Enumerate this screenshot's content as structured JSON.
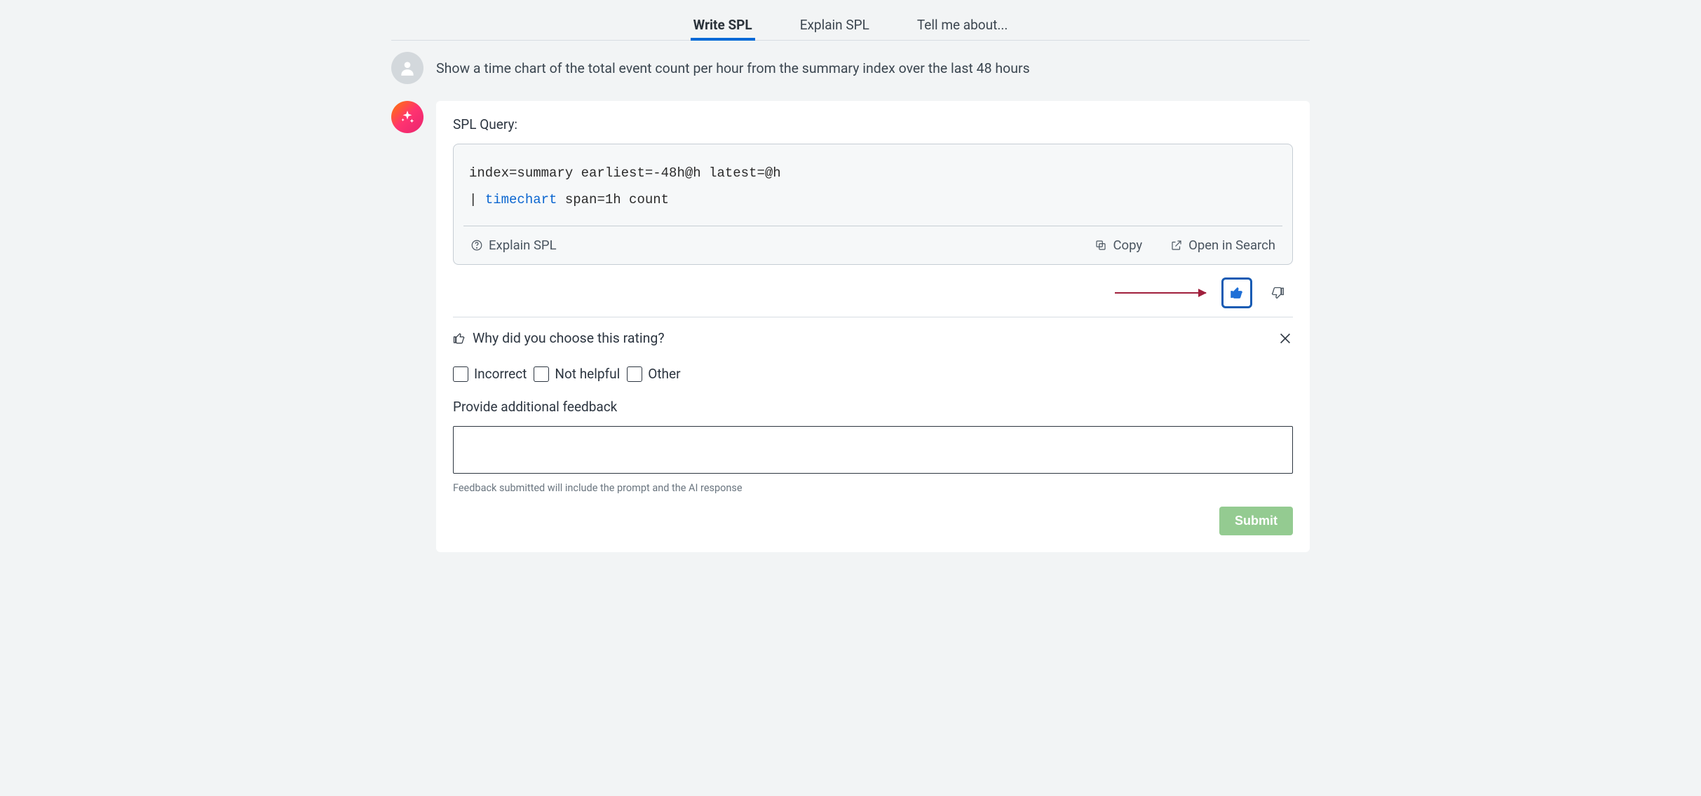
{
  "tabs": [
    {
      "label": "Write SPL",
      "active": true
    },
    {
      "label": "Explain SPL",
      "active": false
    },
    {
      "label": "Tell me about...",
      "active": false
    }
  ],
  "user_message": "Show a time chart of the total event count per hour from the summary index over the last 48 hours",
  "response": {
    "label": "SPL Query:",
    "code_line1": "index=summary earliest=-48h@h latest=@h",
    "code_pipe": "| ",
    "code_keyword": "timechart",
    "code_rest": " span=1h count",
    "explain_label": "Explain SPL",
    "copy_label": "Copy",
    "open_label": "Open in Search"
  },
  "feedback": {
    "title": "Why did you choose this rating?",
    "options": [
      "Incorrect",
      "Not helpful",
      "Other"
    ],
    "subtitle": "Provide additional feedback",
    "hint": "Feedback submitted will include the prompt and the AI response",
    "submit_label": "Submit",
    "thumb_selected": "up"
  }
}
